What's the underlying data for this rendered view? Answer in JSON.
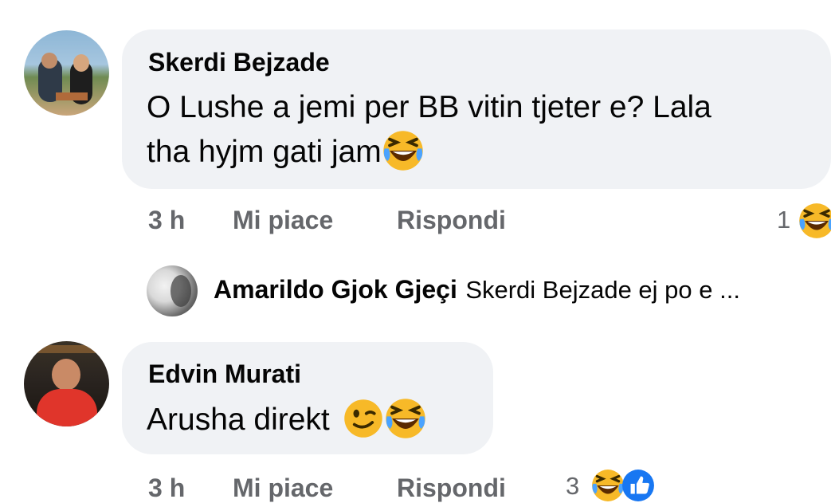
{
  "comments": [
    {
      "author": "Skerdi Bejzade",
      "text_line1": "O Lushe a jemi per BB vitin tjeter e? Lala",
      "text_line2": "tha hyjm gati jam",
      "time": "3 h",
      "like_label": "Mi piace",
      "reply_label": "Rispondi",
      "reaction_count": "1",
      "reply_preview": {
        "author": "Amarildo Gjok Gjeçi",
        "text": "Skerdi Bejzade ej po e ..."
      }
    },
    {
      "author": "Edvin Murati",
      "text": "Arusha direkt",
      "time": "3 h",
      "like_label": "Mi piace",
      "reply_label": "Rispondi",
      "reaction_count": "3"
    }
  ],
  "icons": {
    "laugh": "laughing-emoji-icon",
    "wink": "winking-emoji-icon",
    "like": "like-reaction-icon"
  },
  "colors": {
    "bubble": "#f0f2f5",
    "meta_text": "#65676b",
    "like_blue": "#1877f2",
    "emoji_yellow": "#f7b125"
  }
}
